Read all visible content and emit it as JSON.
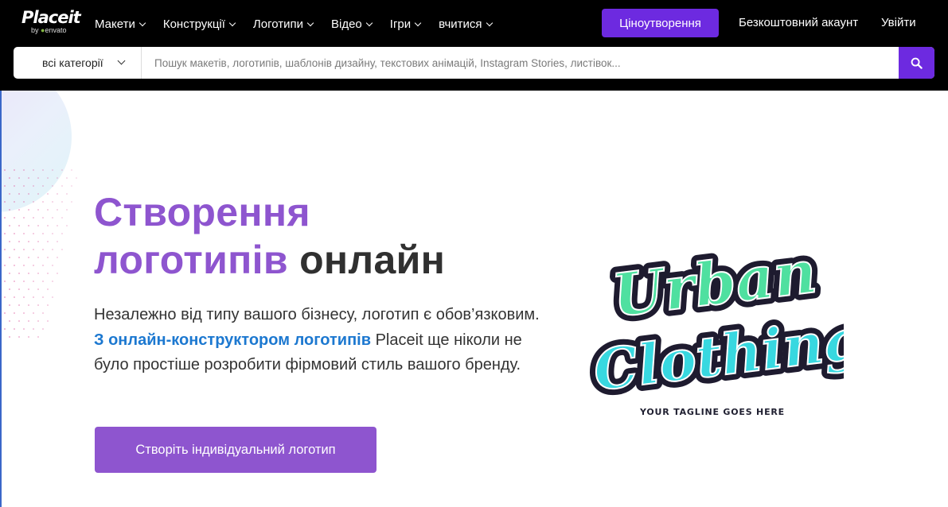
{
  "brand": {
    "name": "Placeit",
    "sub_prefix": "by",
    "sub_name": "envato"
  },
  "nav": {
    "items": [
      {
        "label": "Макети"
      },
      {
        "label": "Конструкції"
      },
      {
        "label": "Логотипи"
      },
      {
        "label": "Відео"
      },
      {
        "label": "Ігри"
      },
      {
        "label": "вчитися"
      }
    ],
    "pricing": "Ціноутворення",
    "free_account": "Безкоштовний акаунт",
    "login": "Увійти"
  },
  "search": {
    "category": "всі категорії",
    "placeholder": "Пошук макетів, логотипів, шаблонів дизайну, текстових анімацій, Instagram Stories, листівок..."
  },
  "hero": {
    "title_line1": "Створення",
    "title_line2_purple": "логотипів",
    "title_line2_dark": "онлайн",
    "desc_part1": "Незалежно від типу вашого бізнесу, логотип є обов’язковим.",
    "desc_link": "З онлайн-конструктором логотипів",
    "desc_part2": "Placeit ще ніколи не було простіше розробити фірмовий стиль вашого бренду.",
    "cta": "Створіть індивідуальний логотип"
  },
  "preview": {
    "word1": "Urban",
    "word2": "Clothing",
    "tagline": "YOUR TAGLINE GOES HERE"
  },
  "colors": {
    "accent": "#6d2ae0",
    "purple": "#8e55cf",
    "link": "#1c78d0",
    "green_text": "#4fe0a0",
    "cyan_text": "#38d8e0"
  },
  "icons": {
    "search": "search-icon",
    "chevron": "chevron-down-icon"
  }
}
